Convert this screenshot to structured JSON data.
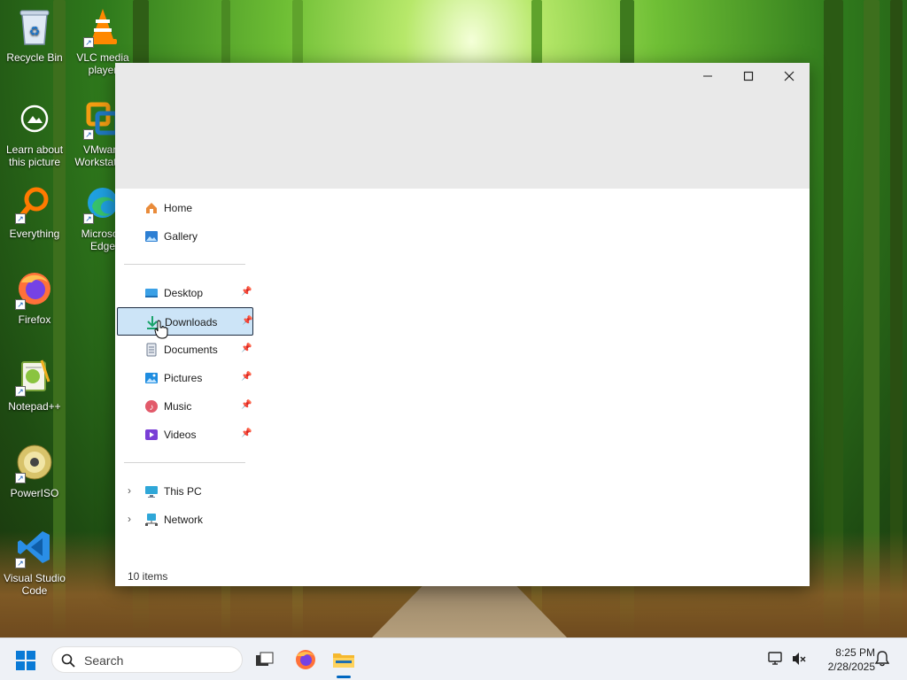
{
  "desktop": {
    "icons": [
      {
        "label_line1": "Recycle Bin",
        "label_line2": ""
      },
      {
        "label_line1": "VLC media",
        "label_line2": "player"
      },
      {
        "label_line1": "Learn about",
        "label_line2": "this picture"
      },
      {
        "label_line1": "VMware",
        "label_line2": "Workstation"
      },
      {
        "label_line1": "Everything",
        "label_line2": ""
      },
      {
        "label_line1": "Microsoft",
        "label_line2": "Edge"
      },
      {
        "label_line1": "Firefox",
        "label_line2": ""
      },
      {
        "label_line1": "Notepad++",
        "label_line2": ""
      },
      {
        "label_line1": "PowerISO",
        "label_line2": ""
      },
      {
        "label_line1": "Visual Studio",
        "label_line2": "Code"
      }
    ]
  },
  "window": {
    "nav": {
      "home": "Home",
      "gallery": "Gallery",
      "desktop": "Desktop",
      "downloads": "Downloads",
      "documents": "Documents",
      "pictures": "Pictures",
      "music": "Music",
      "videos": "Videos",
      "this_pc": "This PC",
      "network": "Network"
    },
    "status_text": "10 items"
  },
  "taskbar": {
    "search_label": "Search",
    "time": "8:25 PM",
    "date": "2/28/2025"
  },
  "colors": {
    "accent": "#0067c0",
    "selection_bg": "#cce4f7",
    "titlebar_bg": "#e9e9e9",
    "taskbar_bg": "#eef1f6"
  }
}
